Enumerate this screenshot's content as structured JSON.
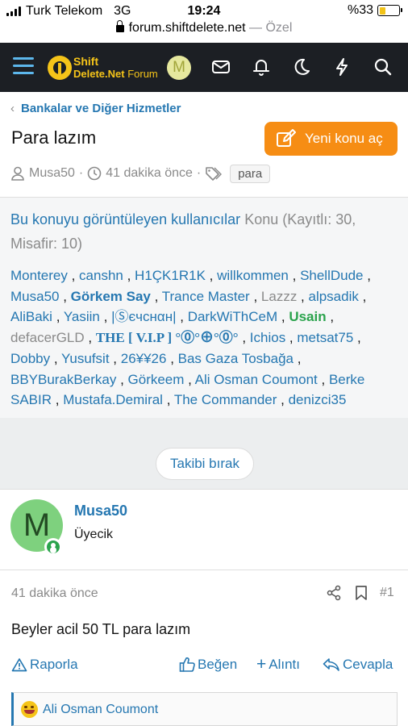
{
  "status_bar": {
    "carrier": "Turk Telekom",
    "network": "3G",
    "time": "19:24",
    "battery": "%33",
    "battery_level": 0.33
  },
  "browser": {
    "domain": "forum.shiftdelete.net",
    "suffix": "— Özel"
  },
  "header": {
    "logo_line1": "Shift",
    "logo_line2": "Delete.Net",
    "logo_line2b": "Forum",
    "avatar_letter": "M",
    "avatar_color": "#e6e89e",
    "accent_color": "#5db7ec",
    "icons": [
      "menu-icon",
      "inbox-icon",
      "bell-icon",
      "moon-icon",
      "lightning-icon",
      "search-icon"
    ]
  },
  "breadcrumb": {
    "label": "Bankalar ve Diğer Hizmetler"
  },
  "thread": {
    "title": "Para lazım",
    "new_thread_label": "Yeni konu aç",
    "author": "Musa50",
    "time": "41 dakika önce",
    "tag": "para",
    "brand_orange": "#f68d14"
  },
  "viewers": {
    "head_link": "Bu konuyu görüntüleyen kullanıcılar",
    "head_rest": "Konu (Kayıtlı: 30, Misafir: 10)",
    "users": [
      {
        "name": "Monterey",
        "style": "u"
      },
      {
        "name": "canshn",
        "style": "u"
      },
      {
        "name": "H1ÇK1R1K",
        "style": "u"
      },
      {
        "name": "willkommen",
        "style": "u"
      },
      {
        "name": "ShellDude",
        "style": "u"
      },
      {
        "name": "Musa50",
        "style": "u"
      },
      {
        "name": "Görkem Say",
        "style": "b"
      },
      {
        "name": "Trance Master",
        "style": "u"
      },
      {
        "name": "Lazzz",
        "style": "g"
      },
      {
        "name": "alpsadik",
        "style": "u"
      },
      {
        "name": "AliBaki",
        "style": "u"
      },
      {
        "name": "Yasiin",
        "style": "u"
      },
      {
        "name": "|Ⓢєчcнαн|",
        "style": "u"
      },
      {
        "name": "DarkWiThCeM",
        "style": "u"
      },
      {
        "name": "Usain",
        "style": "green"
      },
      {
        "name": "defacerGLD",
        "style": "g"
      },
      {
        "name": "THE [ V.I.P ] °⓪°⊕°⓪°",
        "style": "serif"
      },
      {
        "name": "Ichios",
        "style": "u"
      },
      {
        "name": "metsat75",
        "style": "u"
      },
      {
        "name": "Dobby",
        "style": "u"
      },
      {
        "name": "Yusufsit",
        "style": "u"
      },
      {
        "name": "26¥¥26",
        "style": "u"
      },
      {
        "name": "Bas Gaza Tosbağa",
        "style": "u"
      },
      {
        "name": "BBYBurakBerkay",
        "style": "u"
      },
      {
        "name": "Görkeem",
        "style": "u"
      },
      {
        "name": "Ali Osman Coumont",
        "style": "u"
      },
      {
        "name": "Berke SABIR",
        "style": "u"
      },
      {
        "name": "Mustafa.Demiral",
        "style": "u"
      },
      {
        "name": "The Commander",
        "style": "u"
      },
      {
        "name": "denizci35",
        "style": "u"
      }
    ],
    "unwatch_label": "Takibi bırak"
  },
  "post": {
    "avatar_letter": "M",
    "avatar_color": "#7ed17e",
    "username": "Musa50",
    "role": "Üyecik",
    "time": "41 dakika önce",
    "number": "#1",
    "body": "Beyler acil 50 TL para lazım",
    "actions": {
      "report": "Raporla",
      "like": "Beğen",
      "quote": "Alıntı",
      "reply": "Cevapla"
    },
    "reaction_user": "Ali Osman Coumont"
  }
}
